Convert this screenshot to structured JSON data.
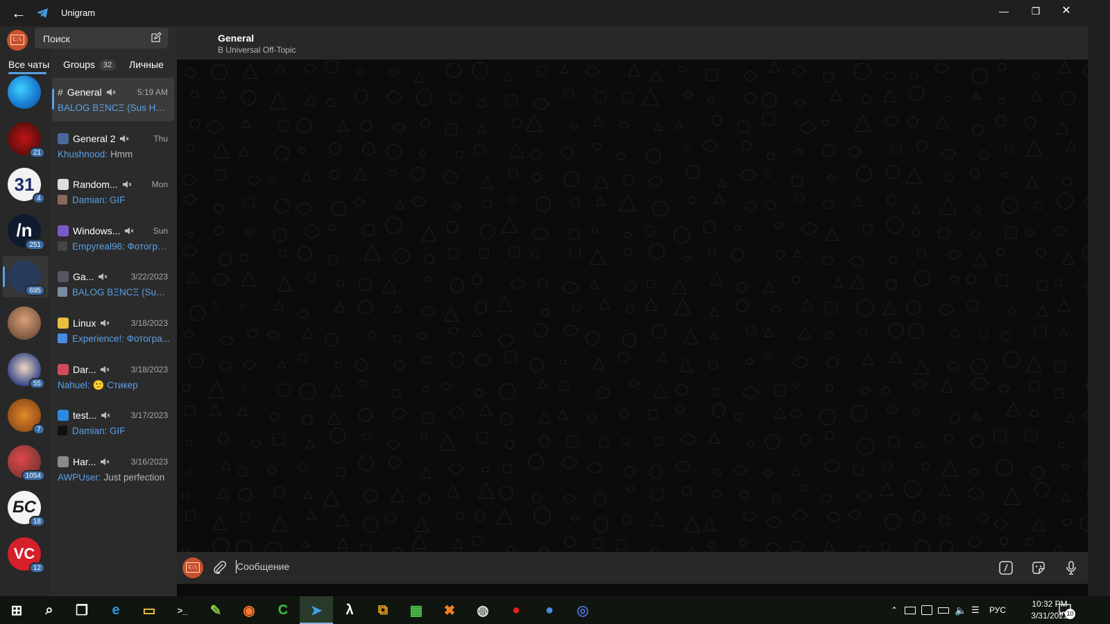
{
  "window": {
    "app_title": "Unigram",
    "controls": [
      "minimize",
      "restore",
      "close"
    ]
  },
  "sidebar": {
    "search_placeholder": "Поиск",
    "tabs": [
      {
        "label": "Все чаты",
        "count": null
      },
      {
        "label": "Groups",
        "count": "32"
      },
      {
        "label": "Личные",
        "count": null
      }
    ],
    "folders": [
      {
        "name": "edge",
        "badge": null
      },
      {
        "name": "test",
        "badge": "21"
      },
      {
        "name": "31",
        "badge": "4"
      },
      {
        "name": "n",
        "text": "/n",
        "badge": "251"
      },
      {
        "name": "ga",
        "badge": "695"
      },
      {
        "name": "face",
        "badge": null
      },
      {
        "name": "anime",
        "badge": "55"
      },
      {
        "name": "lion",
        "badge": "7"
      },
      {
        "name": "phone",
        "badge": "1054"
      },
      {
        "name": "bs",
        "text": "БС",
        "badge": "18"
      },
      {
        "name": "vc",
        "text": "VC",
        "badge": "12"
      }
    ]
  },
  "chats": [
    {
      "title": "General",
      "time": "5:19 AM",
      "sender": "BALOG BΞNCΞ (Sus Hari...",
      "message": ""
    },
    {
      "title": "General 2",
      "time": "Thu",
      "sender": "Khushnood:",
      "message": "Hmm"
    },
    {
      "title": "Random...",
      "time": "Mon",
      "sender": "Damian: GIF",
      "message": ""
    },
    {
      "title": "Windows...",
      "time": "Sun",
      "sender": "Empyreal96: Фотогра...",
      "message": ""
    },
    {
      "title": "Ga...",
      "time": "3/22/2023",
      "sender": "BALOG BΞNCΞ (Sus H...",
      "message": ""
    },
    {
      "title": "Linux",
      "time": "3/18/2023",
      "sender": "Experience!: Фотогра...",
      "message": ""
    },
    {
      "title": "Dar...",
      "time": "3/18/2023",
      "sender": "Nahuel:",
      "message": "🙁 Стикер"
    },
    {
      "title": "test...",
      "time": "3/17/2023",
      "sender": "Damian: GIF",
      "message": ""
    },
    {
      "title": "Har...",
      "time": "3/16/2023",
      "sender": "AWPUser:",
      "message": "Just perfection"
    }
  ],
  "header": {
    "title": "General",
    "subtitle": "В Universal Off-Topic"
  },
  "composer": {
    "placeholder": "Сообщение"
  },
  "taskbar": {
    "apps": [
      "start",
      "search",
      "task-view",
      "edge",
      "explorer",
      "terminal",
      "notepad",
      "firefox",
      "camtasia",
      "telegram",
      "lambda",
      "copy",
      "malware",
      "crossout",
      "steam",
      "record",
      "chat",
      "globe"
    ],
    "language": "РУС",
    "time": "10:32 PM",
    "date": "3/31/2023",
    "notifications": "10"
  },
  "colors": {
    "accent": "#5aa0e6",
    "header_bg": "#282828",
    "chat_bg": "#0b0b0b",
    "taskbar_bg": "#10150f"
  }
}
